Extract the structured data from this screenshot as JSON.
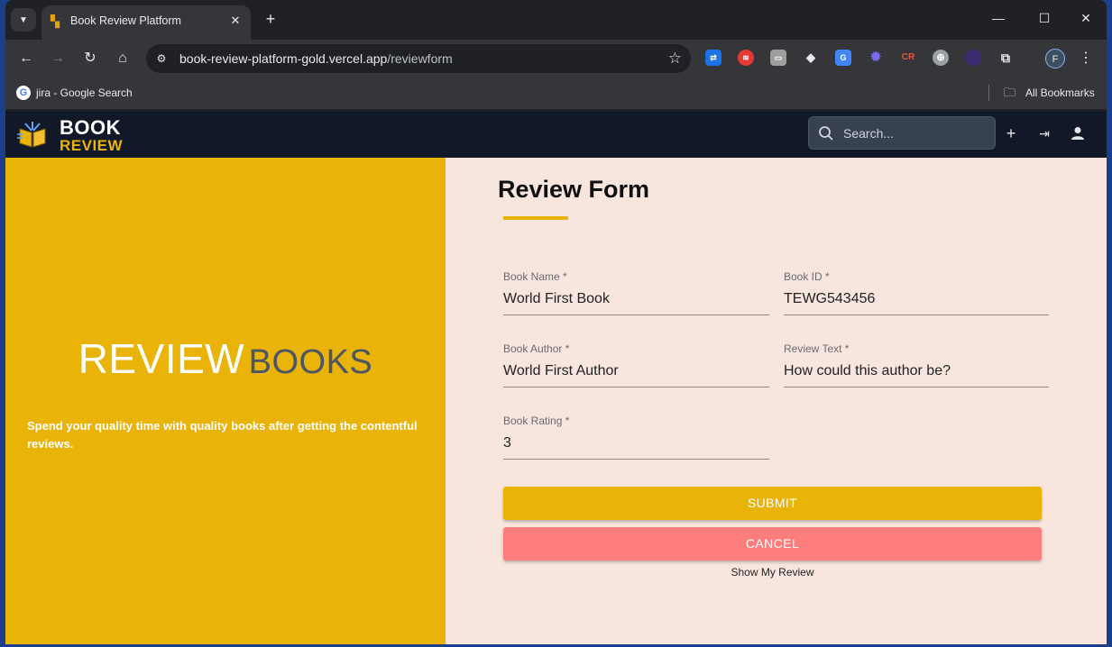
{
  "browser": {
    "tab": {
      "title": "Book Review Platform",
      "close": "✕"
    },
    "new_tab": "+",
    "window_controls": {
      "minimize": "—",
      "maximize": "☐",
      "close": "✕"
    },
    "url": {
      "host": "book-review-platform-gold.vercel.app",
      "path": "/reviewform"
    },
    "bookmarks": {
      "item": "jira - Google Search",
      "all": "All Bookmarks"
    },
    "profile_initial": "F",
    "extensions": [
      "translate-ext",
      "red-circle-ext",
      "window-ext",
      "tag-ext",
      "google-translate-ext",
      "star-ext",
      "cr-ext",
      "globe-ext",
      "moon-ext",
      "puzzle-icon"
    ]
  },
  "app": {
    "logo": {
      "line1": "BOOK",
      "line2": "REVIEW"
    },
    "search": {
      "placeholder": "Search..."
    },
    "colors": {
      "header": "#111827",
      "accent": "#e9b308",
      "cancel": "#fe7e7e",
      "form_bg": "#f8e6de"
    }
  },
  "hero": {
    "title_a": "REVIEW",
    "title_b": "BOOKS",
    "subtitle": "Spend your quality time with quality books after getting the contentful reviews."
  },
  "form": {
    "title": "Review Form",
    "fields": {
      "book_name": {
        "label": "Book Name *",
        "value": "World First Book"
      },
      "book_id": {
        "label": "Book ID *",
        "value": "TEWG543456"
      },
      "book_author": {
        "label": "Book Author *",
        "value": "World First Author"
      },
      "review_text": {
        "label": "Review Text *",
        "value": "How could this author be?"
      },
      "book_rating": {
        "label": "Book Rating *",
        "value": "3"
      }
    },
    "submit_label": "SUBMIT",
    "cancel_label": "CANCEL",
    "show_review_label": "Show My Review"
  }
}
